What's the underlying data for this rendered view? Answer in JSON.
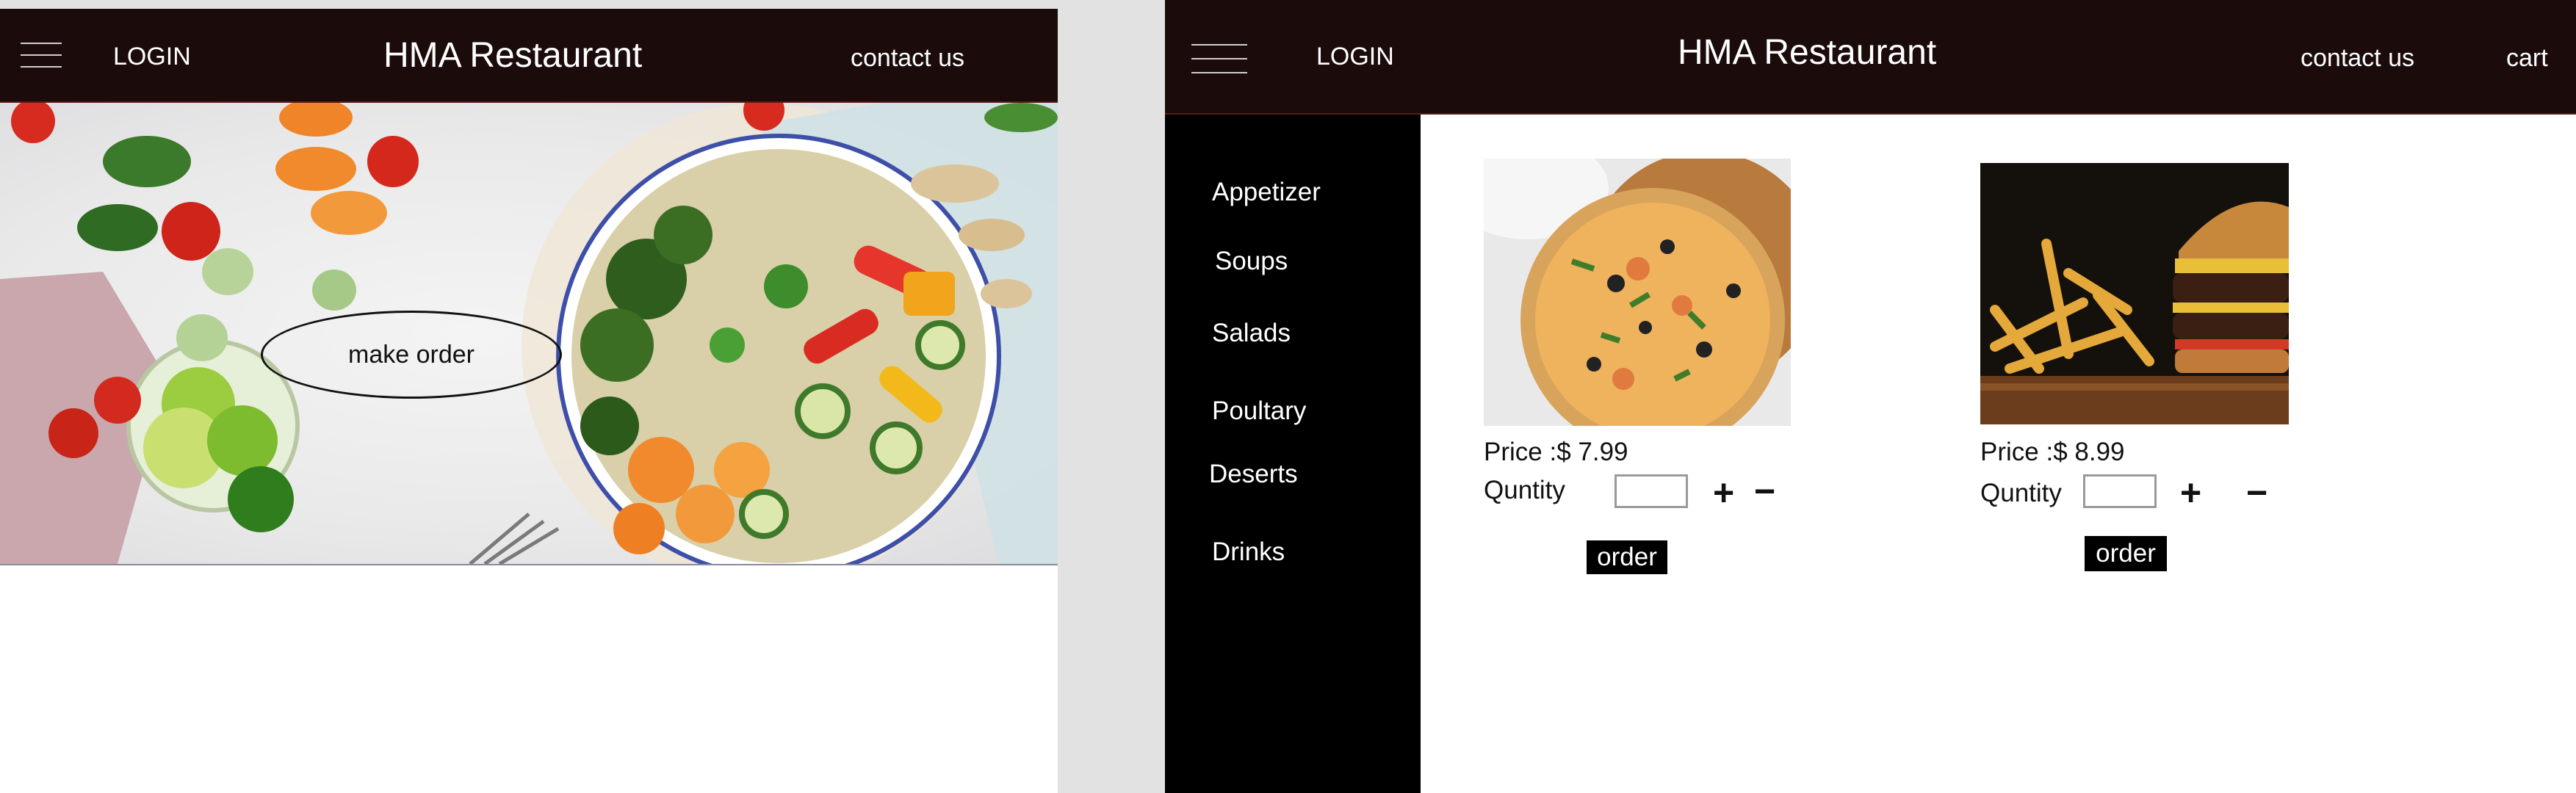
{
  "landing": {
    "header": {
      "login_label": "LOGIN",
      "brand_title": "HMA Restaurant",
      "contact_label": "contact us"
    },
    "hero": {
      "cta_label": "make order"
    }
  },
  "menu_page": {
    "header": {
      "login_label": "LOGIN",
      "brand_title": "HMA Restaurant",
      "contact_label": "contact us",
      "cart_label": "cart"
    },
    "sidebar": {
      "categories": [
        {
          "label": "Appetizer"
        },
        {
          "label": "Soups"
        },
        {
          "label": "Salads"
        },
        {
          "label": "Poultary"
        },
        {
          "label": "Deserts"
        },
        {
          "label": "Drinks"
        }
      ]
    },
    "products": [
      {
        "price_label": "Price :$ 7.99",
        "quantity_label": "Quntity",
        "quantity_value": "",
        "plus": "+",
        "minus": "−",
        "order_label": "order"
      },
      {
        "price_label": "Price :$ 8.99",
        "quantity_label": "Quntity",
        "quantity_value": "",
        "plus": "+",
        "minus": "−",
        "order_label": "order"
      }
    ]
  },
  "colors": {
    "header_bg": "#1b0b0b",
    "sidebar_bg": "#000000",
    "page_bg": "#ffffff",
    "canvas_bg": "#e2e2e2",
    "button_bg": "#000000"
  }
}
